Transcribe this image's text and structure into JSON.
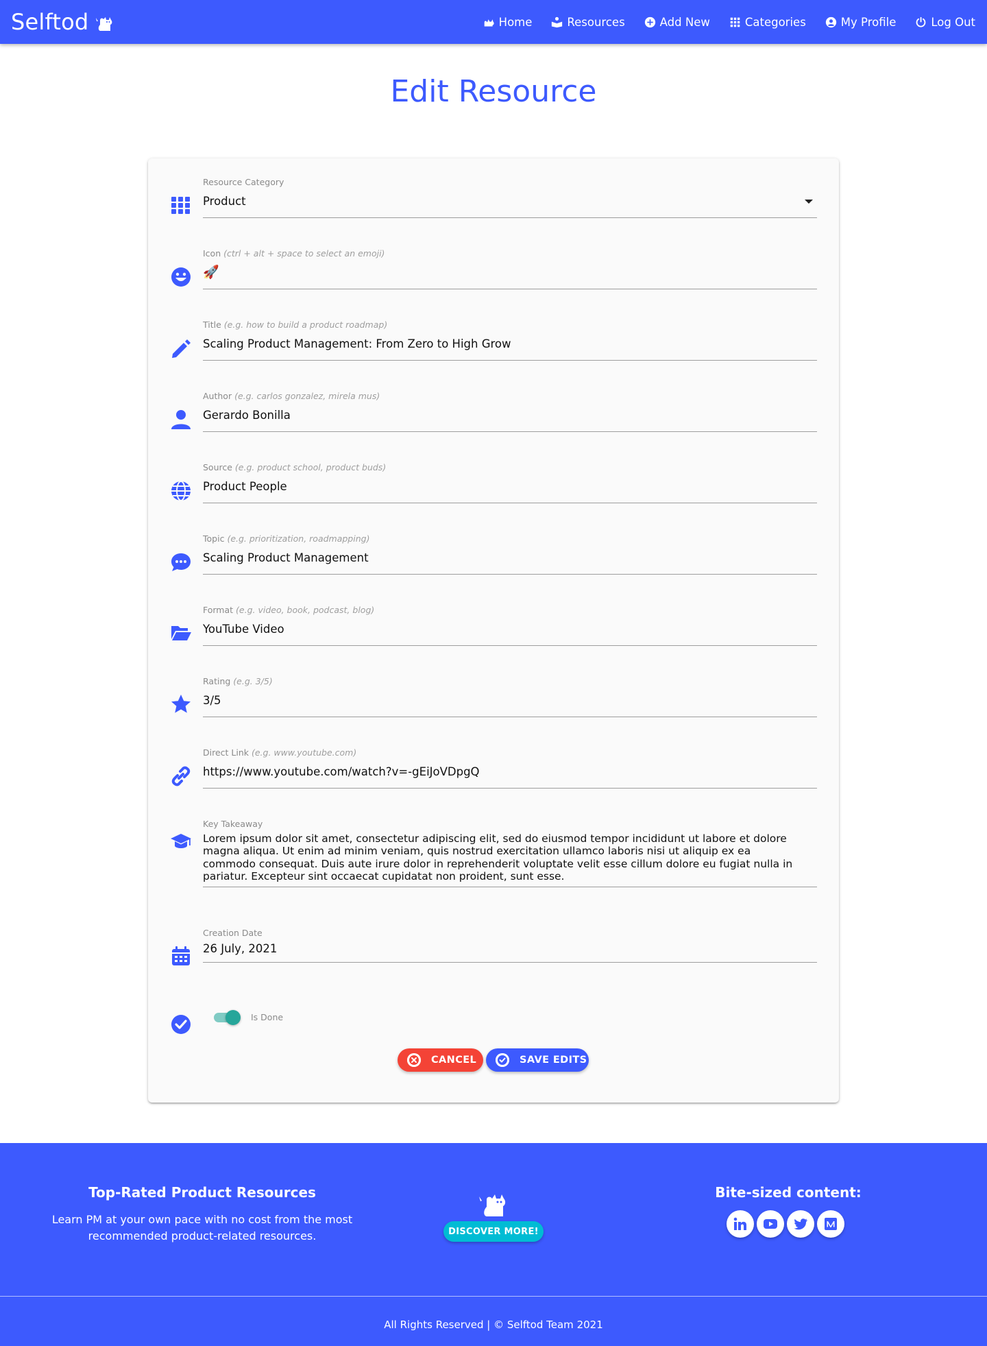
{
  "nav": {
    "brand": "Selftod",
    "links": [
      {
        "label": "Home",
        "icon": "cat-icon"
      },
      {
        "label": "Resources",
        "icon": "reading-icon"
      },
      {
        "label": "Add New",
        "icon": "add-circle-icon"
      },
      {
        "label": "Categories",
        "icon": "grid-icon"
      },
      {
        "label": "My Profile",
        "icon": "account-circle-icon"
      },
      {
        "label": "Log Out",
        "icon": "power-icon"
      }
    ]
  },
  "page": {
    "title": "Edit Resource"
  },
  "form": {
    "category": {
      "label": "Resource Category",
      "value": "Product",
      "icon": "grid-icon"
    },
    "icon_field": {
      "label": "Icon",
      "hint": "(ctrl + alt + space to select an emoji)",
      "value": "🚀",
      "icon": "smile-icon"
    },
    "title": {
      "label": "Title",
      "hint": "(e.g. how to build a product roadmap)",
      "value": "Scaling Product Management: From Zero to High Grow",
      "icon": "pencil-icon"
    },
    "author": {
      "label": "Author",
      "hint": "(e.g. carlos gonzalez, mirela mus)",
      "value": "Gerardo Bonilla",
      "icon": "person-icon"
    },
    "source": {
      "label": "Source",
      "hint": "(e.g. product school, product buds)",
      "value": "Product People",
      "icon": "globe-icon"
    },
    "topic": {
      "label": "Topic",
      "hint": "(e.g. prioritization, roadmapping)",
      "value": "Scaling Product Management",
      "icon": "chat-icon"
    },
    "format": {
      "label": "Format",
      "hint": "(e.g. video, book, podcast, blog)",
      "value": "YouTube Video",
      "icon": "folder-open-icon"
    },
    "rating": {
      "label": "Rating",
      "hint": "(e.g. 3/5)",
      "value": "3/5",
      "icon": "star-icon"
    },
    "link": {
      "label": "Direct Link",
      "hint": "(e.g. www.youtube.com)",
      "value": "https://www.youtube.com/watch?v=-gEiJoVDpgQ",
      "icon": "link-icon"
    },
    "takeaway": {
      "label": "Key Takeaway",
      "value": "Lorem ipsum dolor sit amet, consectetur adipiscing elit, sed do eiusmod tempor incididunt ut labore et dolore magna aliqua. Ut enim ad minim veniam, quis nostrud exercitation ullamco laboris nisi ut aliquip ex ea commodo consequat. Duis aute irure dolor in reprehenderit voluptate velit esse cillum dolore eu fugiat nulla in pariatur. Excepteur sint occaecat cupidatat non proident, sunt esse.",
      "icon": "graduation-cap-icon"
    },
    "date": {
      "label": "Creation Date",
      "value": "26 July, 2021",
      "icon": "calendar-icon"
    },
    "done": {
      "label": "Is Done",
      "checked": true,
      "icon": "check-circle-icon"
    },
    "cancel_label": "CANCEL",
    "save_label": "SAVE EDITS"
  },
  "footer": {
    "heading": "Top-Rated Product Resources",
    "text": "Learn PM at your own pace with no cost from the most recommended product-related resources.",
    "discover_label": "DISCOVER MORE!",
    "social_heading": "Bite-sized content:",
    "socials": [
      "linkedin-icon",
      "youtube-icon",
      "twitter-icon",
      "medium-icon"
    ],
    "copyright": "All Rights Reserved | © Selftod Team 2021"
  },
  "colors": {
    "primary": "#3d5afe",
    "danger": "#f44336",
    "teal": "#26a69a",
    "cyan": "#00bcd4"
  }
}
